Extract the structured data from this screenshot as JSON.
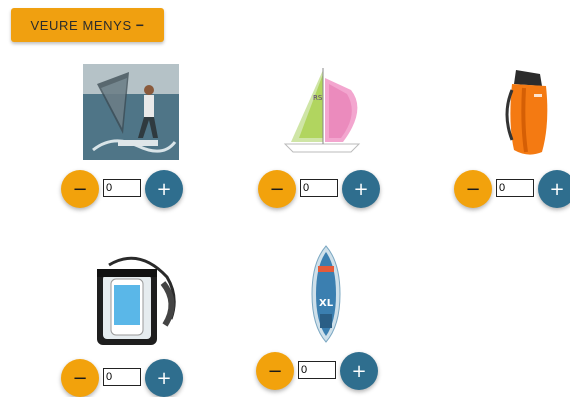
{
  "toggle": {
    "label": "VEURE MENYS",
    "icon_text": "−"
  },
  "colors": {
    "accent_orange": "#f2a20c",
    "accent_blue": "#2f6e8e"
  },
  "products": [
    {
      "name": "windsurf-photo",
      "quantity": "0",
      "minus_label": "−",
      "plus_label": "+"
    },
    {
      "name": "sailboat-photo",
      "quantity": "0",
      "minus_label": "−",
      "plus_label": "+"
    },
    {
      "name": "dry-bag-photo",
      "quantity": "0",
      "minus_label": "−",
      "plus_label": "+"
    },
    {
      "name": "waterproof-phone-case-photo",
      "quantity": "0",
      "minus_label": "−",
      "plus_label": "+"
    },
    {
      "name": "paddle-board-photo",
      "quantity": "0",
      "minus_label": "−",
      "plus_label": "+"
    }
  ]
}
